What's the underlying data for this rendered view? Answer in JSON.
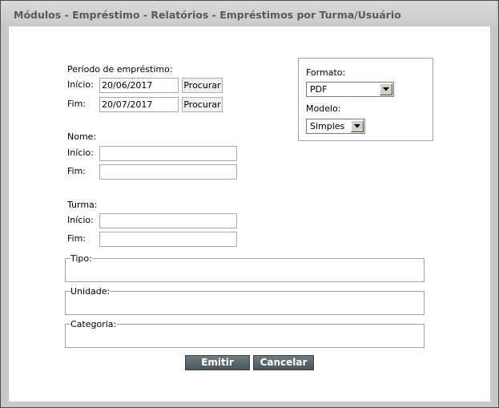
{
  "window": {
    "title": "Módulos - Empréstimo - Relatórios - Empréstimos por Turma/Usuário"
  },
  "periodo": {
    "section_label": "Período de empréstimo:",
    "inicio_label": "Início:",
    "inicio_value": "20/06/2017",
    "fim_label": "Fim:",
    "fim_value": "20/07/2017",
    "procurar_label": "Procurar"
  },
  "nome": {
    "section_label": "Nome:",
    "inicio_label": "Início:",
    "inicio_value": "",
    "fim_label": "Fim:",
    "fim_value": ""
  },
  "turma": {
    "section_label": "Turma:",
    "inicio_label": "Início:",
    "inicio_value": "",
    "fim_label": "Fim:",
    "fim_value": ""
  },
  "opcoes": {
    "formato_label": "Formato:",
    "formato_value": "PDF",
    "modelo_label": "Modelo:",
    "modelo_value": "Simples"
  },
  "fieldsets": {
    "tipo": "Tipo:",
    "unidade": "Unidade:",
    "categoria": "Categoria:"
  },
  "actions": {
    "emitir": "Emitir",
    "cancelar": "Cancelar"
  },
  "colors": {
    "action_button": "#5a6569",
    "frame": "#c8c8c8"
  }
}
